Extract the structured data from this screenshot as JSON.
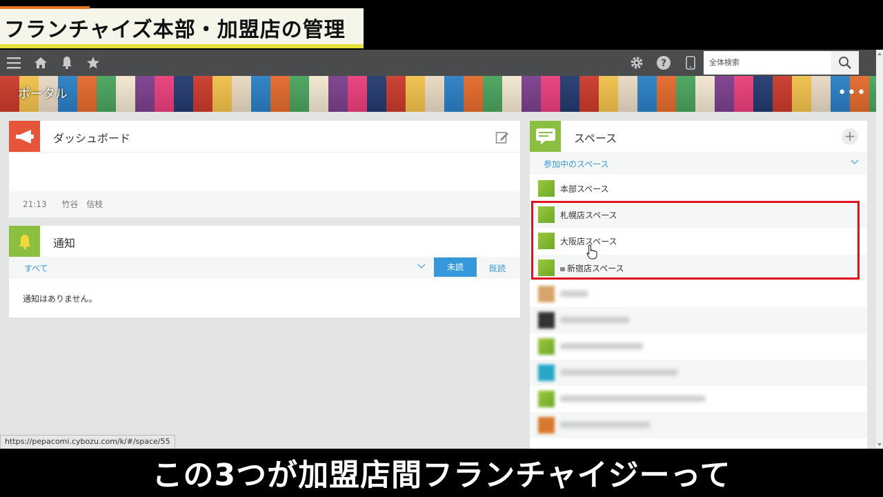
{
  "overlay": {
    "title": "フランチャイズ本部・加盟店の管理",
    "caption": "この3つが加盟店間フランチャイジーって"
  },
  "topbar": {
    "icons": [
      "menu-icon",
      "home-icon",
      "bell-icon",
      "star-icon",
      "gear-icon",
      "help-icon",
      "mobile-icon"
    ],
    "search_placeholder": "全体検索"
  },
  "header": {
    "title": "ポータル"
  },
  "dashboard": {
    "title": "ダッシュボード",
    "time": "21:13",
    "user": "竹谷　信枝"
  },
  "notifications": {
    "title": "通知",
    "filter": "すべて",
    "unread_button": "未読",
    "read_link": "既読",
    "empty_message": "通知はありません。"
  },
  "spaces": {
    "title": "スペース",
    "add_button": "+",
    "joined_label": "参加中のスペース",
    "items": [
      {
        "name": "本部スペース"
      },
      {
        "name": "札幌店スペース"
      },
      {
        "name": "大阪店スペース"
      },
      {
        "name": "新宿店スペース",
        "locked": true
      }
    ]
  },
  "statusbar": {
    "url": "https://pepacomi.cybozu.com/k/#/space/55"
  },
  "colors": {
    "accent": "#3498db",
    "highlight": "#e0141e",
    "topbar": "#4a4b4d"
  }
}
